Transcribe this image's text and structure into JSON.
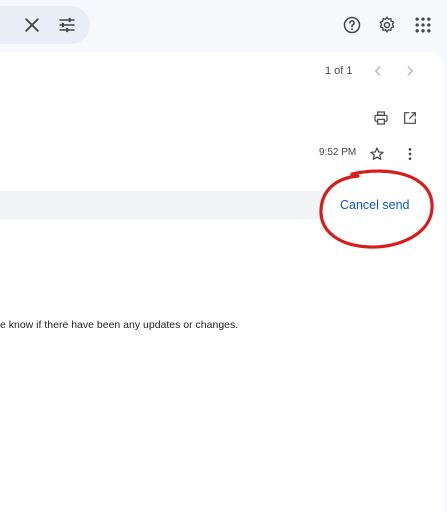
{
  "header": {
    "icons": [
      "close-icon",
      "tune-icon",
      "help-icon",
      "settings-icon",
      "apps-icon"
    ]
  },
  "message": {
    "pager": "1 of 1",
    "time": "9:52 PM",
    "body_text": "e know if there have been any updates or changes."
  },
  "undo_bar": {
    "action_label": "Cancel send",
    "annotation_color": "#d81b1b"
  },
  "colors": {
    "accent": "#0b57d0",
    "background": "#f6f8fc",
    "annotation": "#d81b1b"
  }
}
